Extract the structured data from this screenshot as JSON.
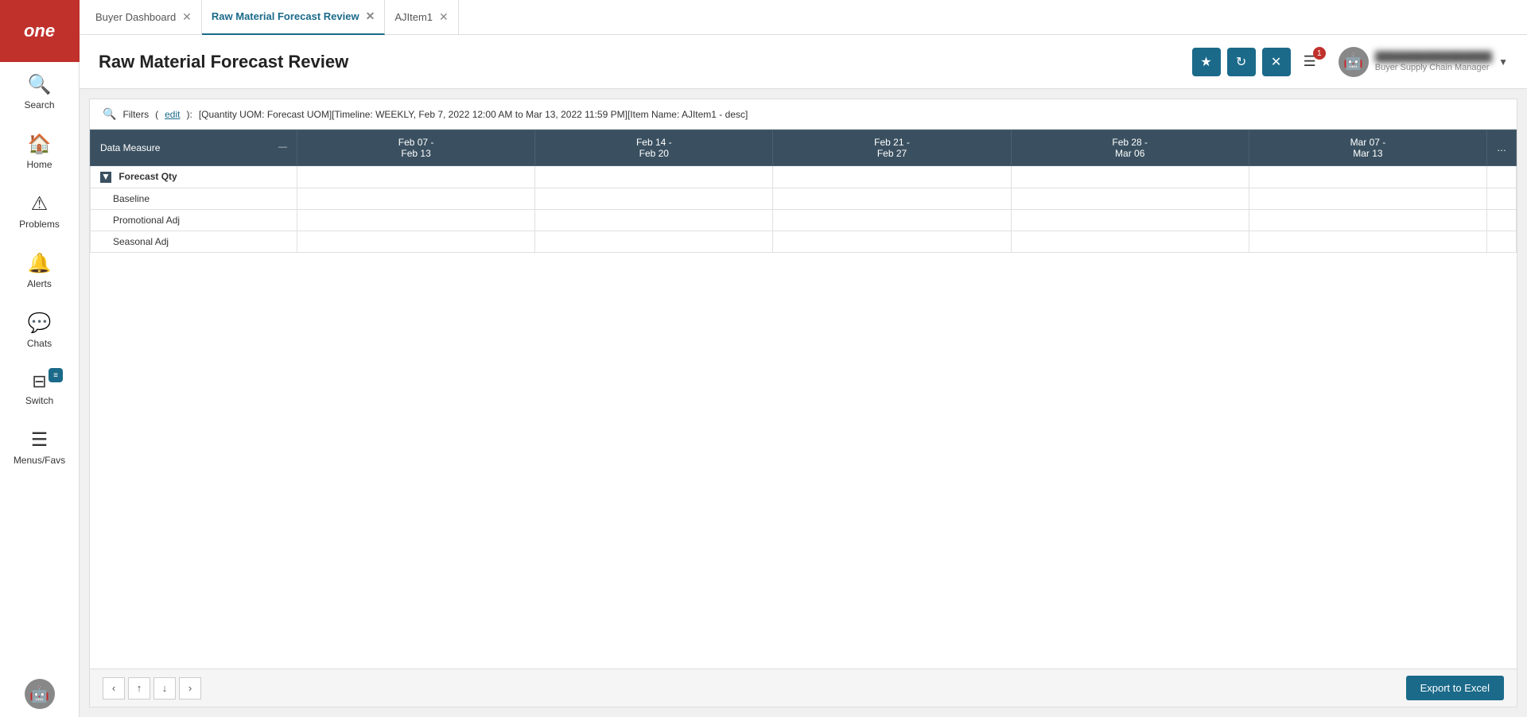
{
  "app": {
    "logo": "one"
  },
  "sidebar": {
    "items": [
      {
        "id": "search",
        "label": "Search",
        "icon": "🔍"
      },
      {
        "id": "home",
        "label": "Home",
        "icon": "🏠"
      },
      {
        "id": "problems",
        "label": "Problems",
        "icon": "⚠"
      },
      {
        "id": "alerts",
        "label": "Alerts",
        "icon": "🔔"
      },
      {
        "id": "chats",
        "label": "Chats",
        "icon": "💬"
      },
      {
        "id": "switch",
        "label": "Switch",
        "icon": "⊞"
      },
      {
        "id": "menus",
        "label": "Menus/Favs",
        "icon": "☰"
      }
    ],
    "switch_badge": "≡"
  },
  "tabs": [
    {
      "id": "buyer-dashboard",
      "label": "Buyer Dashboard",
      "active": false,
      "closable": true
    },
    {
      "id": "raw-material-forecast",
      "label": "Raw Material Forecast Review",
      "active": true,
      "closable": true
    },
    {
      "id": "ajitem1",
      "label": "AJItem1",
      "active": false,
      "closable": true
    }
  ],
  "header": {
    "title": "Raw Material Forecast Review",
    "buttons": {
      "star": "★",
      "refresh": "↻",
      "close": "✕",
      "menu": "☰"
    },
    "notification_count": "1",
    "user": {
      "name": "Buyer Supply Chain Manager",
      "role": ""
    }
  },
  "filter": {
    "label": "Filters",
    "edit_label": "edit",
    "tags": "[Quantity UOM: Forecast UOM][Timeline: WEEKLY, Feb 7, 2022 12:00 AM to Mar 13, 2022 11:59 PM][Item Name: AJItem1 - desc]"
  },
  "grid": {
    "columns": [
      {
        "id": "data-measure",
        "label": "Data Measure"
      },
      {
        "id": "feb07-13",
        "label": "Feb 07 -\nFeb 13"
      },
      {
        "id": "feb14-20",
        "label": "Feb 14 -\nFeb 20"
      },
      {
        "id": "feb21-27",
        "label": "Feb 21 -\nFeb 27"
      },
      {
        "id": "feb28-mar06",
        "label": "Feb 28 -\nMar 06"
      },
      {
        "id": "mar07-13",
        "label": "Mar 07 -\nMar 13"
      }
    ],
    "rows": [
      {
        "id": "forecast-qty",
        "label": "Forecast Qty",
        "type": "group",
        "collapsed": false,
        "children": [
          {
            "id": "baseline",
            "label": "Baseline"
          },
          {
            "id": "promotional-adj",
            "label": "Promotional Adj"
          },
          {
            "id": "seasonal-adj",
            "label": "Seasonal Adj"
          }
        ]
      }
    ]
  },
  "footer": {
    "export_button": "Export to Excel",
    "pagination": {
      "prev_page": "‹",
      "up": "↑",
      "down": "↓",
      "next_page": "›"
    }
  }
}
